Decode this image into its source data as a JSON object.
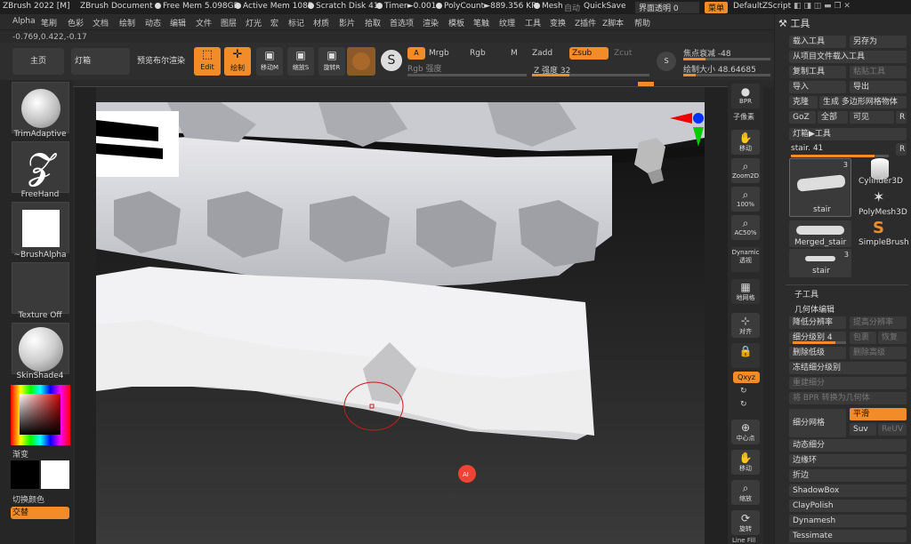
{
  "titlebar": {
    "app": "ZBrush 2022 [M]",
    "doc": "ZBrush Document",
    "free_mem": "Free Mem 5.098GB",
    "active_mem": "Active Mem 1085",
    "scratch": "Scratch Disk 41",
    "timer": "Timer►0.001",
    "polycount": "PolyCount►889.356 KP",
    "mesh": "Mesh",
    "auto": "自动",
    "quicksave": "QuickSave",
    "ui_transparency": "界面透明 0",
    "menu": "菜单",
    "script": "DefaultZScript"
  },
  "menubar": [
    "Alpha",
    "笔刷",
    "色彩",
    "文档",
    "绘制",
    "动态",
    "编辑",
    "文件",
    "图层",
    "灯光",
    "宏",
    "标记",
    "材质",
    "影片",
    "拾取",
    "首选项",
    "渲染",
    "模板",
    "笔触",
    "纹理",
    "工具",
    "变换",
    "Z插件",
    "Z脚本",
    "帮助"
  ],
  "coords": "-0.769,0.422,-0.17",
  "shelf": {
    "home": "主页",
    "lightbox": "灯箱",
    "preview_bool": "预览布尔渲染",
    "edit": "Edit",
    "draw": "绘制",
    "move": "移动M",
    "scale": "缩放S",
    "rotate": "旋转R",
    "a": "A",
    "mrgb": "Mrgb",
    "rgb": "Rgb",
    "m": "M",
    "zadd": "Zadd",
    "zsub": "Zsub",
    "zcut": "Zcut",
    "rgb_strength": "Rgb 强度",
    "z_strength": "Z 强度 32",
    "focal_shift": "焦点衰减 -48",
    "draw_size": "绘制大小 48.64685",
    "s": "S"
  },
  "z_strength_value": 32,
  "focal_shift_value": -48,
  "lefttray": {
    "trim": "TrimAdaptive",
    "freehand": "FreeHand",
    "brushalpha": "~BrushAlpha",
    "texture": "Texture Off",
    "material": "SkinShade4",
    "gradient": "渐变",
    "switch_color": "切换颜色",
    "alternate": "交替"
  },
  "rightshelf": {
    "bpr": "BPR",
    "subpixel": "子像素",
    "move": "移动",
    "zoom2d": "Zoom2D",
    "zoom100": "100%",
    "ac50": "AC50%",
    "dynamic": "Dynamic",
    "persp": "透视",
    "floor": "地网格",
    "local": "对齐",
    "xyz": "Qxyz",
    "center": "中心点",
    "move2": "移动",
    "zoom": "缩放",
    "rotate": "旋转",
    "linefill": "Line Fill"
  },
  "panel": {
    "title": "工具",
    "load": "载入工具",
    "saveas": "另存为",
    "load_project": "从项目文件载入工具",
    "copy": "复制工具",
    "paste": "粘贴工具",
    "import": "导入",
    "export": "导出",
    "clone": "克隆",
    "make_polymesh": "生成 多边形网格物体",
    "goz": "GoZ",
    "all": "全部",
    "visible": "可见",
    "r": "R",
    "lightbox_tool": "灯箱▶工具",
    "tool_name": "stair. 41",
    "tools": [
      {
        "name": "stair",
        "count": "3"
      },
      {
        "name": "Cylinder3D"
      },
      {
        "name": "PolyMesh3D"
      },
      {
        "name": "Merged_stair"
      },
      {
        "name": "SimpleBrush"
      },
      {
        "name": "stair",
        "count": "3"
      }
    ],
    "subtool": "子工具",
    "geometry": "几何体编辑",
    "lower_res": "降低分辨率",
    "higher_res": "提高分辨率",
    "sdiv": "细分级别 4",
    "cage": "包裹",
    "restore": "恢复",
    "del_lower": "删除低级",
    "del_higher": "删除高级",
    "freeze_sdiv": "冻结细分级别",
    "reconstruct": "重建细分",
    "bpr_to_geo": "将 BPR 转换为几何体",
    "divide": "细分网格",
    "smooth": "平滑",
    "suv": "Suv",
    "reuv": "ReUV",
    "dynamic_sub": "动态细分",
    "edge_loop": "边缘环",
    "crease": "折边",
    "shadowbox": "ShadowBox",
    "claypolish": "ClayPolish",
    "dynamesh": "Dynamesh",
    "tessimate": "Tessimate"
  },
  "sdiv_value": 4
}
